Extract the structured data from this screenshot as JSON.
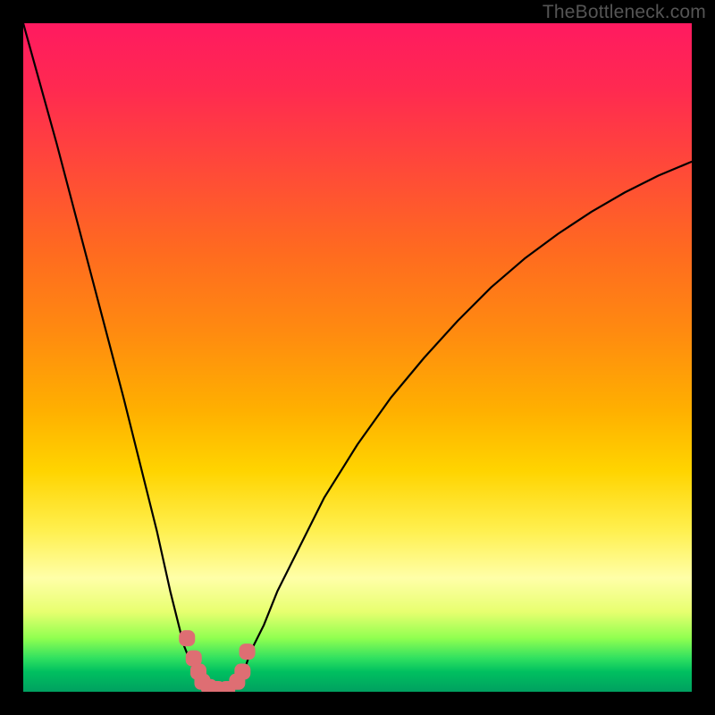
{
  "watermark": "TheBottleneck.com",
  "colors": {
    "curve_stroke": "#000000",
    "marker_fill": "#de6e73",
    "marker_stroke": "#de6e73"
  },
  "chart_data": {
    "type": "line",
    "title": "",
    "xlabel": "",
    "ylabel": "",
    "xlim": [
      0,
      100
    ],
    "ylim": [
      0,
      100
    ],
    "x": [
      0,
      5,
      10,
      15,
      20,
      22,
      24,
      26,
      27,
      28,
      29,
      30,
      31,
      32,
      33,
      34,
      36,
      38,
      40,
      45,
      50,
      55,
      60,
      65,
      70,
      75,
      80,
      85,
      90,
      95,
      100
    ],
    "values": [
      100,
      82,
      63,
      44,
      24,
      15,
      7,
      2,
      0,
      0,
      0,
      0,
      0,
      1,
      3,
      6,
      10,
      15,
      19,
      29,
      37,
      44,
      50,
      55.5,
      60.5,
      64.8,
      68.5,
      71.8,
      74.7,
      77.2,
      79.3
    ],
    "markers": {
      "x": [
        24.5,
        25.5,
        26.2,
        26.8,
        27.8,
        29.0,
        30.5,
        32.0,
        32.8,
        33.5
      ],
      "y": [
        8,
        5,
        3,
        1.5,
        0.7,
        0.4,
        0.4,
        1.5,
        3,
        6
      ]
    }
  }
}
